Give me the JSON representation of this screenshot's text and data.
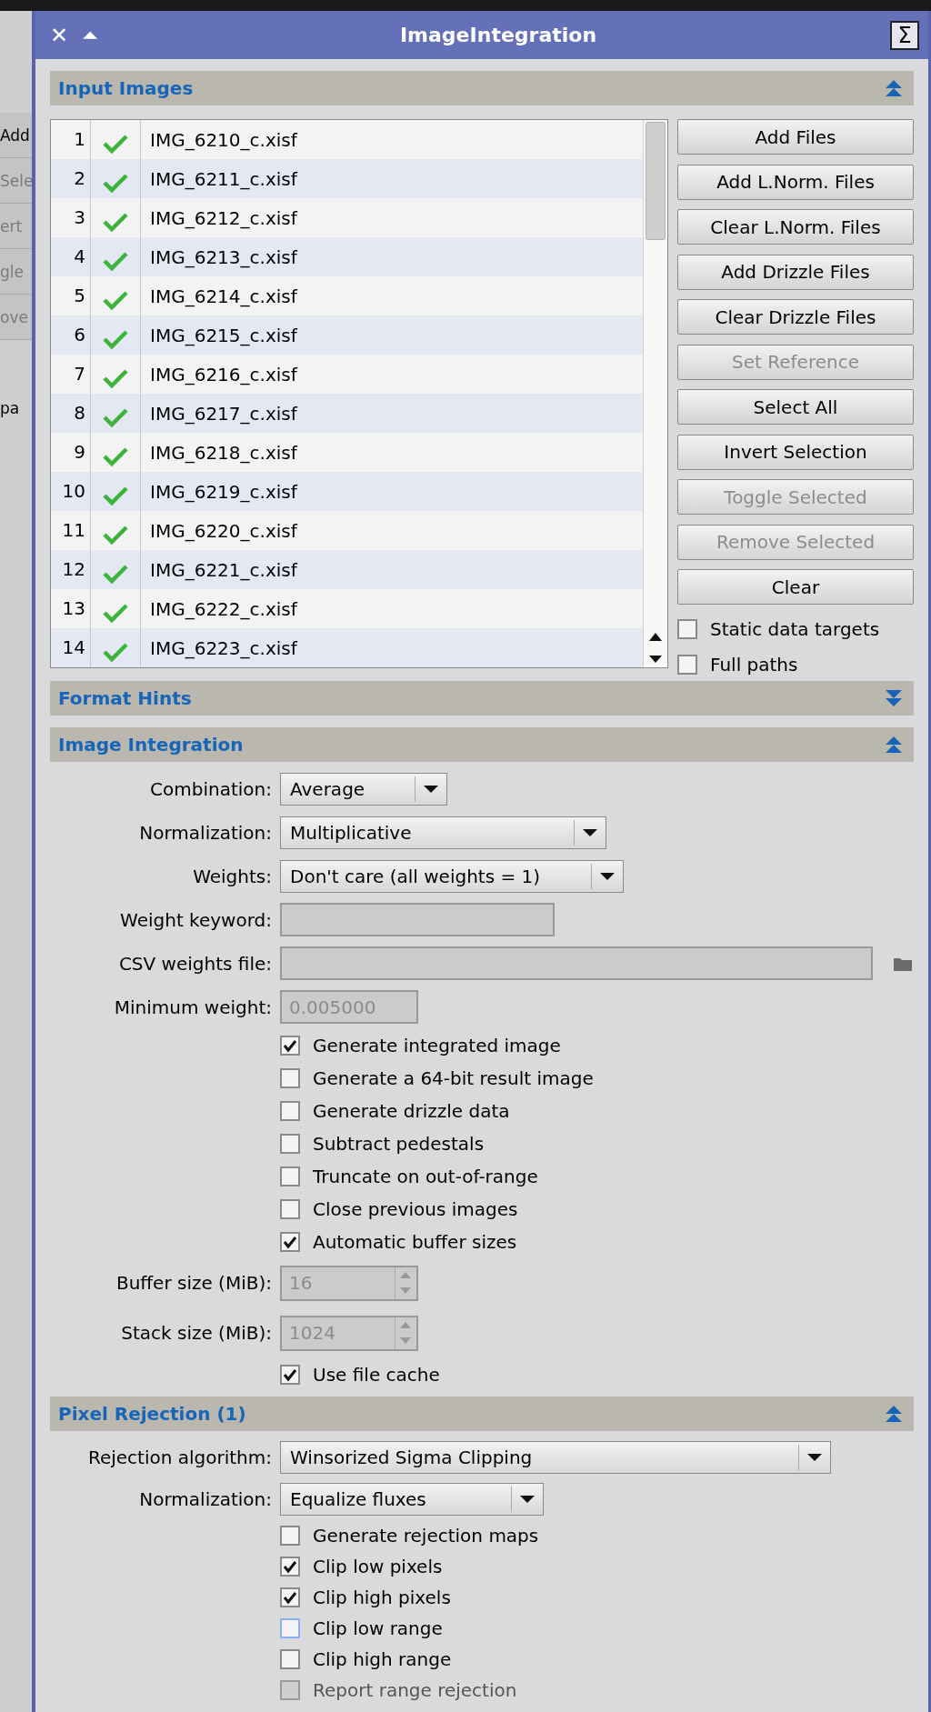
{
  "background_window": {
    "fragments": [
      {
        "text": "Add",
        "disabled": false
      },
      {
        "text": "Sele",
        "disabled": true
      },
      {
        "text": "ert",
        "disabled": true
      },
      {
        "text": "gle",
        "disabled": true
      },
      {
        "text": "ove",
        "disabled": true
      },
      {
        "text": "pa",
        "disabled": false
      }
    ]
  },
  "window": {
    "title": "ImageIntegration",
    "close_glyph": "✕",
    "shade_glyph": "⏶",
    "process_glyph": "Σ"
  },
  "input_images": {
    "title": "Input Images",
    "expanded": true,
    "files": [
      {
        "index": "1",
        "enabled": true,
        "name": "IMG_6210_c.xisf"
      },
      {
        "index": "2",
        "enabled": true,
        "name": "IMG_6211_c.xisf"
      },
      {
        "index": "3",
        "enabled": true,
        "name": "IMG_6212_c.xisf"
      },
      {
        "index": "4",
        "enabled": true,
        "name": "IMG_6213_c.xisf"
      },
      {
        "index": "5",
        "enabled": true,
        "name": "IMG_6214_c.xisf"
      },
      {
        "index": "6",
        "enabled": true,
        "name": "IMG_6215_c.xisf"
      },
      {
        "index": "7",
        "enabled": true,
        "name": "IMG_6216_c.xisf"
      },
      {
        "index": "8",
        "enabled": true,
        "name": "IMG_6217_c.xisf"
      },
      {
        "index": "9",
        "enabled": true,
        "name": "IMG_6218_c.xisf"
      },
      {
        "index": "10",
        "enabled": true,
        "name": "IMG_6219_c.xisf"
      },
      {
        "index": "11",
        "enabled": true,
        "name": "IMG_6220_c.xisf"
      },
      {
        "index": "12",
        "enabled": true,
        "name": "IMG_6221_c.xisf"
      },
      {
        "index": "13",
        "enabled": true,
        "name": "IMG_6222_c.xisf"
      },
      {
        "index": "14",
        "enabled": true,
        "name": "IMG_6223_c.xisf"
      }
    ],
    "buttons": [
      {
        "label": "Add Files",
        "disabled": false
      },
      {
        "label": "Add L.Norm. Files",
        "disabled": false
      },
      {
        "label": "Clear L.Norm. Files",
        "disabled": false
      },
      {
        "label": "Add Drizzle Files",
        "disabled": false
      },
      {
        "label": "Clear Drizzle Files",
        "disabled": false
      },
      {
        "label": "Set Reference",
        "disabled": true
      },
      {
        "label": "Select All",
        "disabled": false
      },
      {
        "label": "Invert Selection",
        "disabled": false
      },
      {
        "label": "Toggle Selected",
        "disabled": true
      },
      {
        "label": "Remove Selected",
        "disabled": true
      },
      {
        "label": "Clear",
        "disabled": false
      }
    ],
    "options": [
      {
        "label": "Static data targets",
        "checked": false
      },
      {
        "label": "Full paths",
        "checked": false
      }
    ]
  },
  "format_hints": {
    "title": "Format Hints",
    "expanded": false
  },
  "image_integration": {
    "title": "Image Integration",
    "expanded": true,
    "rows": [
      {
        "kind": "dropdown",
        "label": "Combination:",
        "value": "Average"
      },
      {
        "kind": "dropdown",
        "label": "Normalization:",
        "value": "Multiplicative"
      },
      {
        "kind": "dropdown",
        "label": "Weights:",
        "value": "Don't care (all weights = 1)"
      },
      {
        "kind": "field",
        "label": "Weight keyword:",
        "disabled": true
      },
      {
        "kind": "file",
        "label": "CSV weights file:",
        "disabled": true
      },
      {
        "kind": "field",
        "label": "Minimum weight:",
        "value": "0.005000",
        "disabled": true
      },
      {
        "kind": "checkbox",
        "label": "Generate integrated image",
        "checked": true
      },
      {
        "kind": "checkbox",
        "label": "Generate a 64-bit result image",
        "checked": false
      },
      {
        "kind": "checkbox",
        "label": "Generate drizzle data",
        "checked": false
      },
      {
        "kind": "checkbox",
        "label": "Subtract pedestals",
        "checked": false
      },
      {
        "kind": "checkbox",
        "label": "Truncate on out-of-range",
        "checked": false
      },
      {
        "kind": "checkbox",
        "label": "Close previous images",
        "checked": false
      },
      {
        "kind": "checkbox",
        "label": "Automatic buffer sizes",
        "checked": true
      },
      {
        "kind": "spinbox",
        "label": "Buffer size (MiB):",
        "value": "16",
        "disabled": true
      },
      {
        "kind": "spinbox",
        "label": "Stack size (MiB):",
        "value": "1024",
        "disabled": true
      },
      {
        "kind": "checkbox",
        "label": "Use file cache",
        "checked": true
      }
    ]
  },
  "pixel_rejection": {
    "title": "Pixel Rejection (1)",
    "expanded": true,
    "rows": [
      {
        "kind": "dropdown",
        "label": "Rejection algorithm:",
        "value": "Winsorized Sigma Clipping"
      },
      {
        "kind": "dropdown",
        "label": "Normalization:",
        "value": "Equalize fluxes"
      },
      {
        "kind": "checkbox",
        "label": "Generate rejection maps",
        "checked": false
      },
      {
        "kind": "checkbox",
        "label": "Clip low pixels",
        "checked": true
      },
      {
        "kind": "checkbox",
        "label": "Clip high pixels",
        "checked": true
      },
      {
        "kind": "checkbox",
        "label": "Clip low range",
        "checked": false,
        "focused": true
      },
      {
        "kind": "checkbox",
        "label": "Clip high range",
        "checked": false
      },
      {
        "kind": "checkbox",
        "label": "Report range rejection",
        "checked": false,
        "disabled": true
      }
    ]
  }
}
